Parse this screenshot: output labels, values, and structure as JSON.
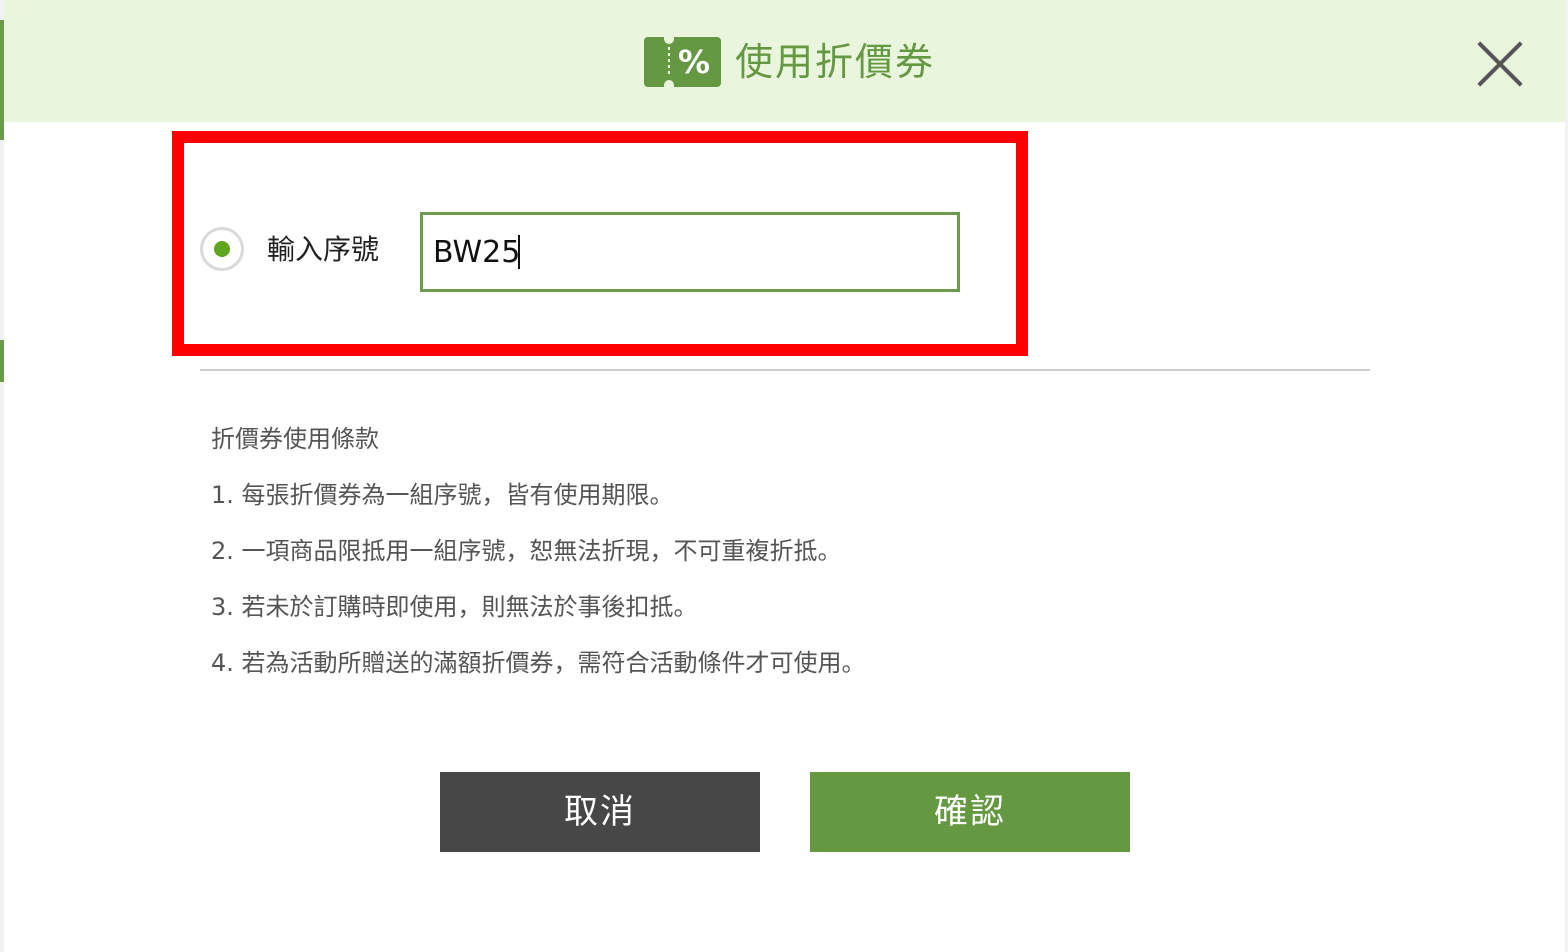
{
  "header": {
    "title": "使用折價券",
    "icon_symbol": "%",
    "icon": "coupon-ticket-icon",
    "close_icon": "close-icon"
  },
  "form": {
    "radio_label": "輸入序號",
    "radio_selected": true,
    "code_value": "BW25"
  },
  "terms": {
    "title": "折價券使用條款",
    "items": [
      "1. 每張折價券為一組序號，皆有使用期限。",
      "2. 一項商品限抵用一組序號，恕無法折現，不可重複折抵。",
      "3. 若未於訂購時即使用，則無法於事後扣抵。",
      "4. 若為活動所贈送的滿額折價券，需符合活動條件才可使用。"
    ]
  },
  "buttons": {
    "cancel_label": "取消",
    "confirm_label": "確認"
  },
  "colors": {
    "header_bg": "#eaf5de",
    "accent_green": "#649841",
    "radio_dot": "#5fa61e",
    "cancel_bg": "#474747",
    "highlight_red": "#ff0000"
  }
}
